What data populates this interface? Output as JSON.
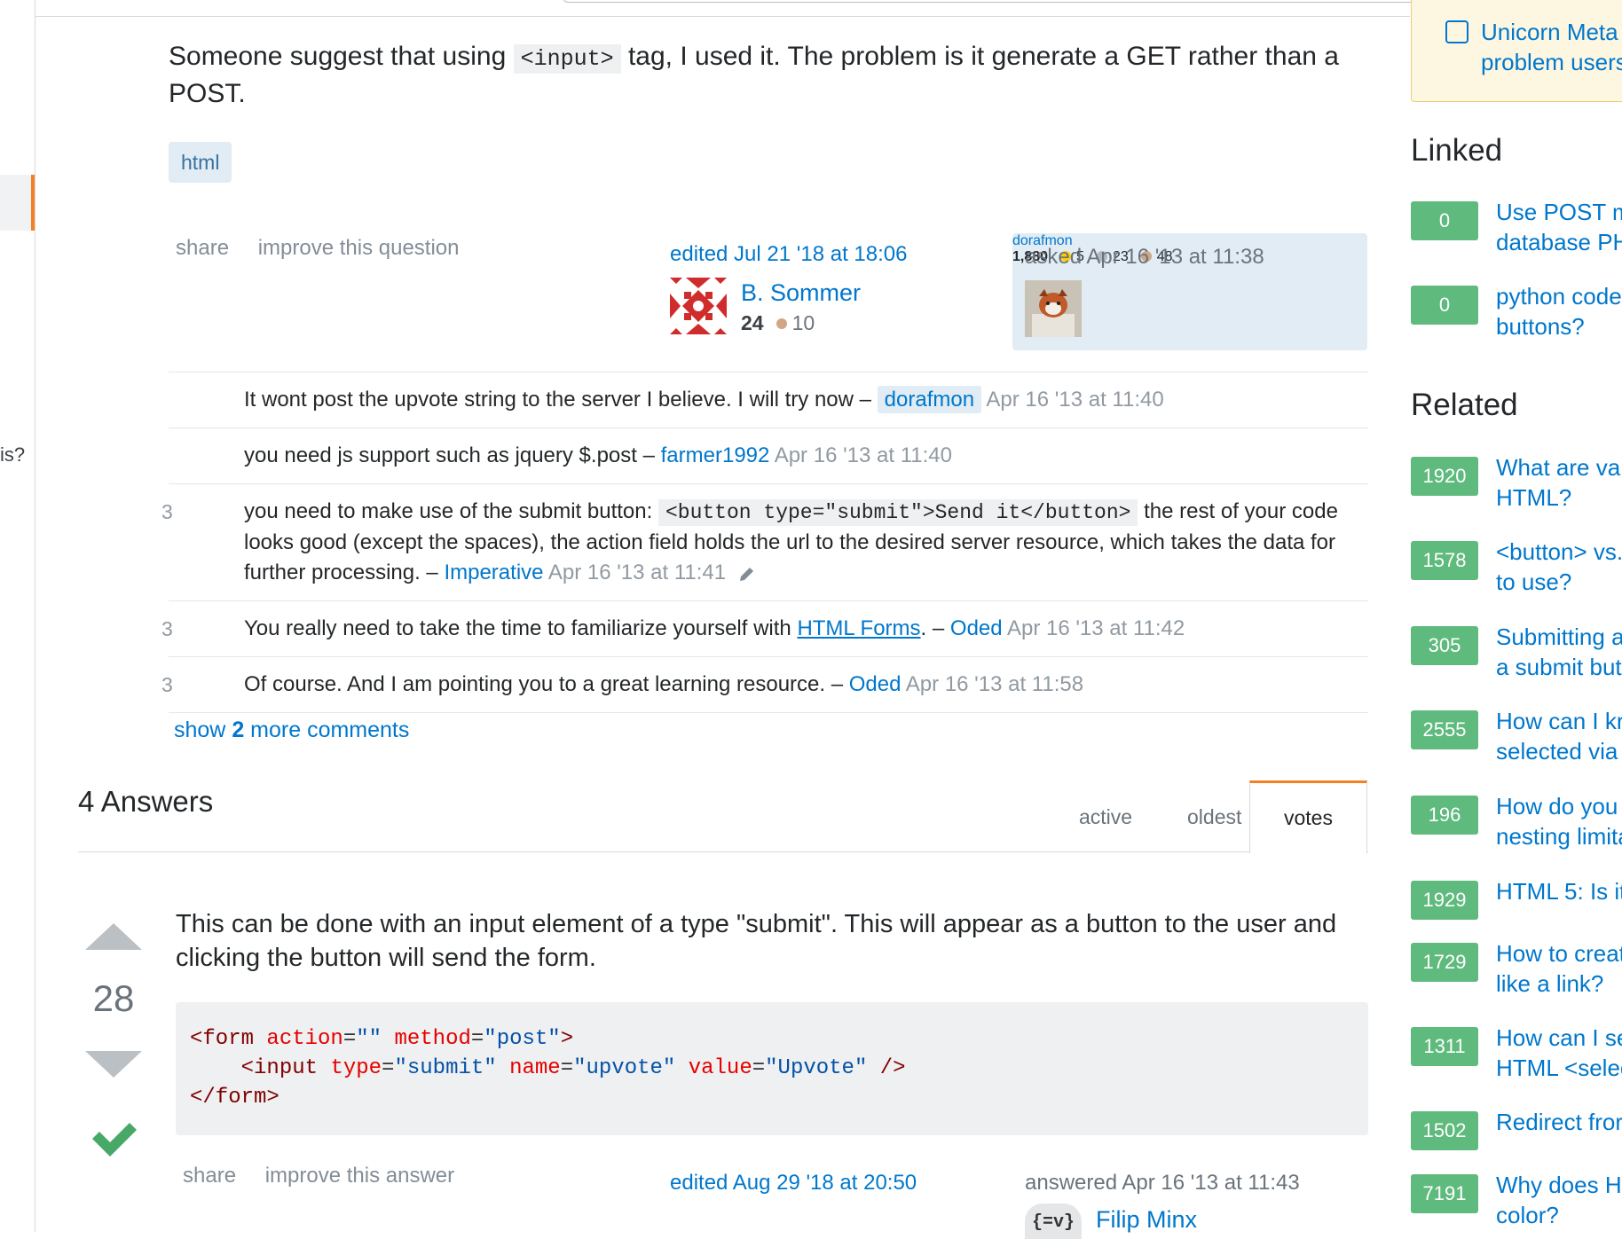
{
  "left_nav": {
    "fragment_text": "is?"
  },
  "question": {
    "text_before_code": "Someone suggest that using ",
    "inline_code": "<input>",
    "text_after_code": " tag, I used it. The problem is it generate a GET rather than a POST.",
    "tag": "html",
    "menu": {
      "share": "share",
      "improve": "improve this question"
    },
    "edited": {
      "label": "edited Jul 21 '18 at 18:06",
      "user": "B. Sommer",
      "rep": "24",
      "bronze": "10"
    },
    "asked": {
      "label": "asked Apr 16 '13 at 11:38",
      "user": "dorafmon",
      "rep": "1,880",
      "gold": "5",
      "silver": "23",
      "bronze": "48"
    }
  },
  "comments": [
    {
      "score": "",
      "text": "It wont post the upvote string to the server I believe. I will try now – ",
      "user": "dorafmon",
      "date": "Apr 16 '13 at 11:40"
    },
    {
      "score": "",
      "text": "you need js support such as jquery $.post – ",
      "user": "farmer1992",
      "date": "Apr 16 '13 at 11:40"
    },
    {
      "score": "3",
      "text_before_code": "you need to make use of the submit button: ",
      "code": "<button type=\"submit\">Send it</button>",
      "text_after_code": " the rest of your code looks good (except the spaces), the action field holds the url to the desired server resource, which takes the data for further processing. – ",
      "user": "Imperative",
      "date": "Apr 16 '13 at 11:41"
    },
    {
      "score": "3",
      "text_before_link": "You really need to take the time to familiarize yourself with ",
      "link": "HTML Forms",
      "text_after_link": ". – ",
      "user": "Oded",
      "date": "Apr 16 '13 at 11:42"
    },
    {
      "score": "3",
      "text": "Of course. And I am pointing you to a great learning resource. – ",
      "user": "Oded",
      "date": "Apr 16 '13 at 11:58"
    }
  ],
  "show_more": {
    "prefix": "show ",
    "count": "2",
    "suffix": " more comments"
  },
  "answers": {
    "heading": "4 Answers",
    "tabs": [
      "active",
      "oldest",
      "votes"
    ],
    "answer": {
      "votes": "28",
      "text": "This can be done with an input element of a type \"submit\". This will appear as a button to the user and clicking the button will send the form.",
      "code_lines": {
        "l1_tag_open": "<form",
        "l1_attr1": "action",
        "l1_val1": "\"\"",
        "l1_attr2": "method",
        "l1_val2": "\"post\"",
        "l1_close": ">",
        "l2_tag": "<input",
        "l2_attr1": "type",
        "l2_val1": "\"submit\"",
        "l2_attr2": "name",
        "l2_val2": "\"upvote\"",
        "l2_attr3": "value",
        "l2_val3": "\"Upvote\"",
        "l2_close": "/>",
        "l3": "</form>"
      },
      "menu": {
        "share": "share",
        "improve": "improve this answer"
      },
      "edited": "edited Aug 29 '18 at 20:50",
      "answered": "answered Apr 16 '13 at 11:43",
      "answerer": "Filip Minx"
    }
  },
  "sidebar": {
    "meta_box": {
      "line1": "Unicorn Meta",
      "line2": "problem users"
    },
    "linked_heading": "Linked",
    "linked": [
      {
        "score": "0",
        "line1": "Use POST m",
        "line2": "database PH"
      },
      {
        "score": "0",
        "line1": "python code",
        "line2": "buttons?"
      }
    ],
    "related_heading": "Related",
    "related": [
      {
        "score": "1920",
        "line1": "What are va",
        "line2": "HTML?"
      },
      {
        "score": "1578",
        "line1": "<button> vs.",
        "line2": "to use?"
      },
      {
        "score": "305",
        "line1": "Submitting a",
        "line2": "a submit but"
      },
      {
        "score": "2555",
        "line1": "How can I kr",
        "line2": "selected via"
      },
      {
        "score": "196",
        "line1": "How do you",
        "line2": "nesting limita"
      },
      {
        "score": "1929",
        "line1": "HTML 5: Is it",
        "line2": ""
      },
      {
        "score": "1729",
        "line1": "How to creat",
        "line2": "like a link?"
      },
      {
        "score": "1311",
        "line1": "How can I se",
        "line2": "HTML <selec"
      },
      {
        "score": "1502",
        "line1": "Redirect fror",
        "line2": ""
      },
      {
        "score": "7191",
        "line1": "Why does H",
        "line2": "color?"
      }
    ]
  }
}
